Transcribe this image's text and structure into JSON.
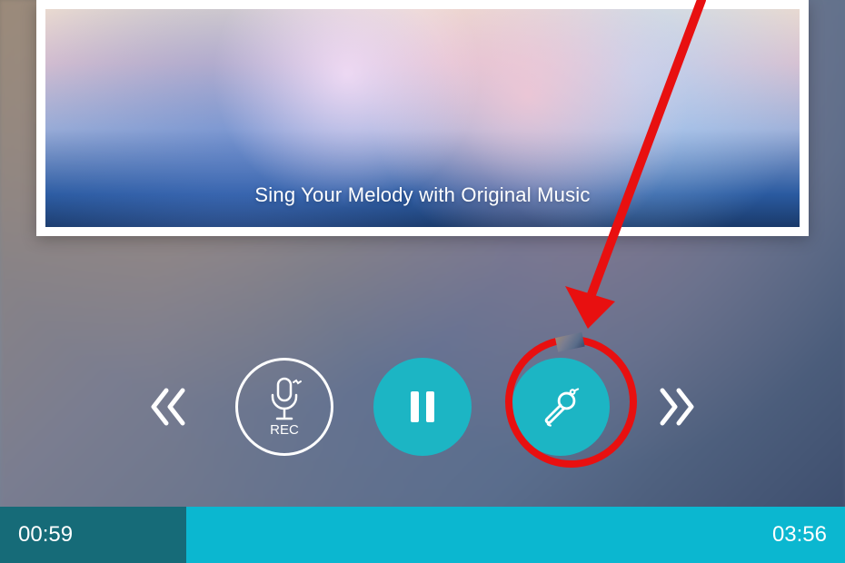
{
  "album": {
    "tagline": "Sing Your Melody with Original Music"
  },
  "controls": {
    "rec_label": "REC"
  },
  "progress": {
    "elapsed": "00:59",
    "total": "03:56",
    "percent": 22
  },
  "colors": {
    "teal": "#1cb5c4",
    "teal_dark": "#166b78",
    "annotation_red": "#e81010"
  }
}
